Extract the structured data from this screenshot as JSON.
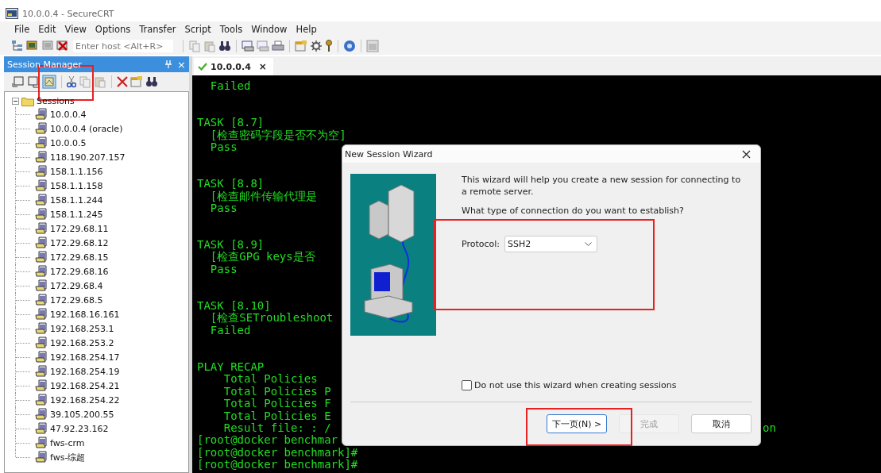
{
  "window": {
    "title": "10.0.0.4 - SecureCRT"
  },
  "menu": [
    "File",
    "Edit",
    "View",
    "Options",
    "Transfer",
    "Script",
    "Tools",
    "Window",
    "Help"
  ],
  "toolbar": {
    "host_placeholder": "Enter host <Alt+R>"
  },
  "session_manager": {
    "title": "Session Manager",
    "close": "×",
    "tree": {
      "label": "Sessions",
      "expanded": true,
      "children": [
        {
          "label": "10.0.0.4"
        },
        {
          "label": "10.0.0.4 (oracle)"
        },
        {
          "label": "10.0.0.5"
        },
        {
          "label": "118.190.207.157"
        },
        {
          "label": "158.1.1.156"
        },
        {
          "label": "158.1.1.158"
        },
        {
          "label": "158.1.1.244"
        },
        {
          "label": "158.1.1.245"
        },
        {
          "label": "172.29.68.11"
        },
        {
          "label": "172.29.68.12"
        },
        {
          "label": "172.29.68.15"
        },
        {
          "label": "172.29.68.16"
        },
        {
          "label": "172.29.68.4"
        },
        {
          "label": "172.29.68.5"
        },
        {
          "label": "192.168.16.161"
        },
        {
          "label": "192.168.253.1"
        },
        {
          "label": "192.168.253.2"
        },
        {
          "label": "192.168.254.17"
        },
        {
          "label": "192.168.254.19"
        },
        {
          "label": "192.168.254.21"
        },
        {
          "label": "192.168.254.22"
        },
        {
          "label": "39.105.200.55"
        },
        {
          "label": "47.92.23.162"
        },
        {
          "label": "fws-crm"
        },
        {
          "label": "fws-综超"
        }
      ]
    }
  },
  "tabs": [
    {
      "label": "10.0.0.4",
      "selected": true,
      "close": "×"
    }
  ],
  "terminal": {
    "lines": [
      {
        "kind": "text",
        "text": "  Failed"
      },
      {
        "kind": "blank"
      },
      {
        "kind": "blank"
      },
      {
        "kind": "text",
        "text": "TASK [8.7]"
      },
      {
        "kind": "text",
        "text": "  [检查密码字段是否不为空]"
      },
      {
        "kind": "text",
        "text": "  Pass"
      },
      {
        "kind": "blank"
      },
      {
        "kind": "blank"
      },
      {
        "kind": "text",
        "text": "TASK [8.8]"
      },
      {
        "kind": "text",
        "text": "  [检查邮件传输代理是"
      },
      {
        "kind": "text",
        "text": "  Pass"
      },
      {
        "kind": "blank"
      },
      {
        "kind": "blank"
      },
      {
        "kind": "text",
        "text": "TASK [8.9]"
      },
      {
        "kind": "text",
        "text": "  [检查GPG keys是否"
      },
      {
        "kind": "text",
        "text": "  Pass"
      },
      {
        "kind": "blank"
      },
      {
        "kind": "blank"
      },
      {
        "kind": "text",
        "text": "TASK [8.10]"
      },
      {
        "kind": "text",
        "text": "  [检查SETroubleshoot"
      },
      {
        "kind": "text",
        "text": "  Failed"
      },
      {
        "kind": "blank"
      },
      {
        "kind": "blank"
      },
      {
        "kind": "text",
        "text": "PLAY RECAP"
      },
      {
        "kind": "text",
        "text": "    Total Policies"
      },
      {
        "kind": "text",
        "text": "    Total Policies P"
      },
      {
        "kind": "text",
        "text": "    Total Policies F"
      },
      {
        "kind": "text",
        "text": "    Total Policies E"
      },
      {
        "kind": "text",
        "text": "    Result file: : /",
        "tail": "on"
      },
      {
        "kind": "text",
        "text": "[root@docker benchmar"
      },
      {
        "kind": "text",
        "text": "[root@docker benchmark]#"
      },
      {
        "kind": "text",
        "text": "[root@docker benchmark]#"
      }
    ]
  },
  "dialog": {
    "title": "New Session Wizard",
    "intro": "This wizard will help you create a new session for connecting to a remote server.",
    "question": "What type of connection do you want to establish?",
    "protocol_label": "Protocol:",
    "protocol_value": "SSH2",
    "checkbox": {
      "label": "Do not use this wizard when creating sessions",
      "checked": false
    },
    "buttons": [
      {
        "label": "下一页(N) >",
        "disabled": false,
        "default": true
      },
      {
        "label": "完成",
        "disabled": true,
        "default": false
      },
      {
        "label": "取消",
        "disabled": false,
        "default": false
      }
    ]
  }
}
